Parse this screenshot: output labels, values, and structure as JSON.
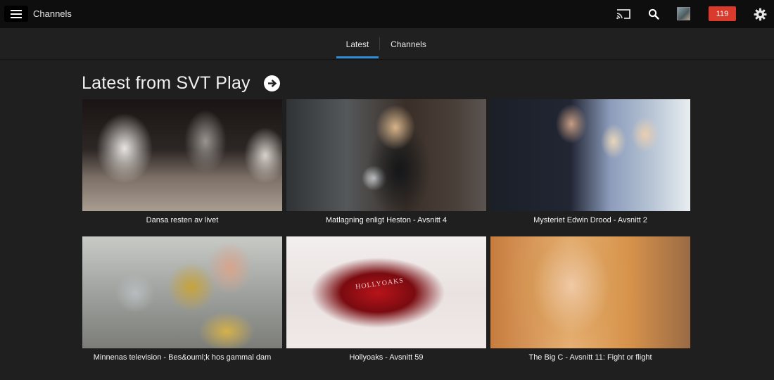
{
  "header": {
    "title": "Channels",
    "notification_count": "119",
    "icons": [
      "menu-icon",
      "cast-icon",
      "search-icon",
      "avatar",
      "gear-icon"
    ]
  },
  "tabs": [
    {
      "label": "Latest",
      "active": true
    },
    {
      "label": "Channels",
      "active": false
    }
  ],
  "section": {
    "title": "Latest from SVT Play"
  },
  "items": [
    {
      "title": "Dansa resten av livet"
    },
    {
      "title": "Matlagning enligt Heston - Avsnitt 4"
    },
    {
      "title": "Mysteriet Edwin Drood - Avsnitt 2"
    },
    {
      "title": "Minnenas television - Bes&ouml;k hos gammal dam"
    },
    {
      "title": "Hollyoaks - Avsnitt 59",
      "thumb_text": "HOLLYOAKS"
    },
    {
      "title": "The Big C - Avsnitt 11: Fight or flight"
    }
  ],
  "colors": {
    "accent": "#2e8bd6",
    "badge": "#d93a2b",
    "background": "#1f1f1f",
    "topbar": "#0e0e0e"
  }
}
